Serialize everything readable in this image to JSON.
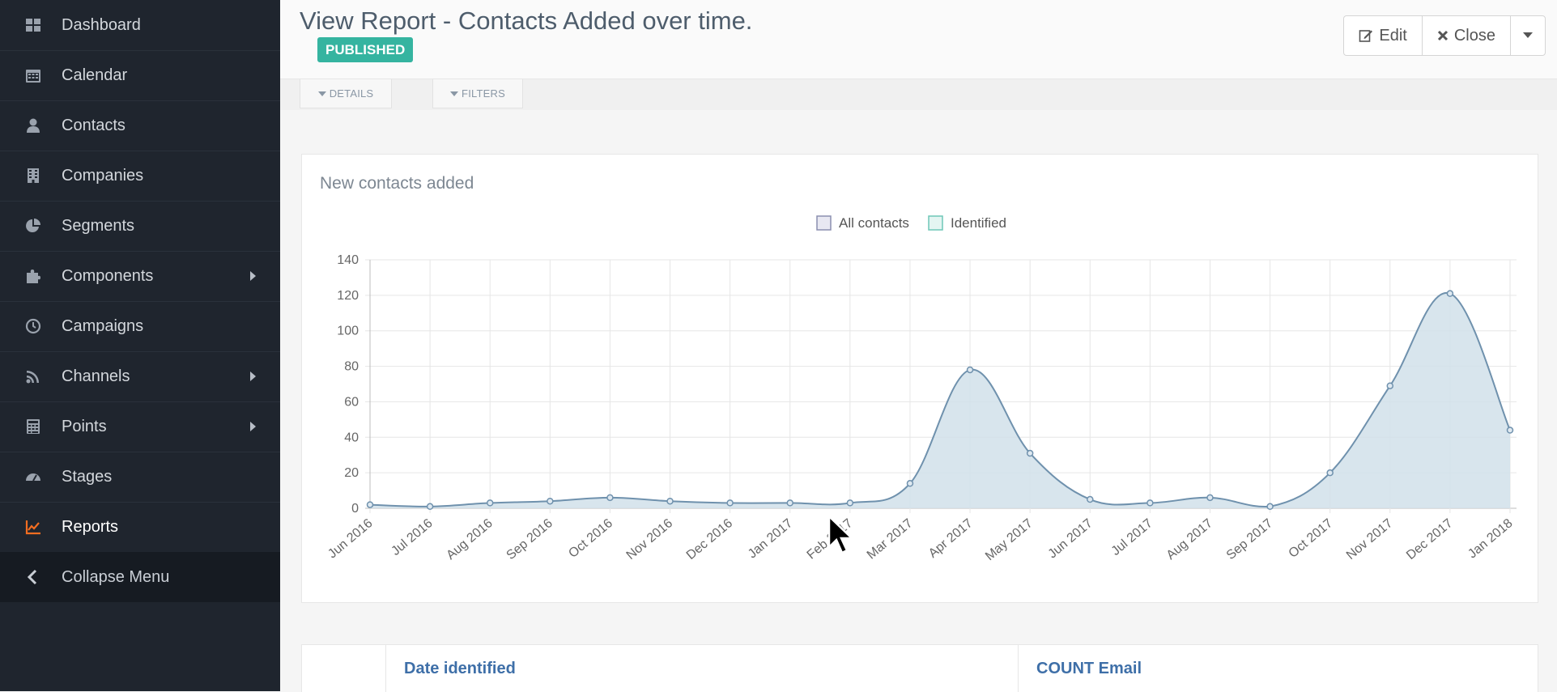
{
  "sidebar": {
    "items": [
      {
        "label": "Dashboard",
        "icon": "dashboard-icon",
        "has_submenu": false
      },
      {
        "label": "Calendar",
        "icon": "calendar-icon",
        "has_submenu": false
      },
      {
        "label": "Contacts",
        "icon": "user-icon",
        "has_submenu": false
      },
      {
        "label": "Companies",
        "icon": "building-icon",
        "has_submenu": false
      },
      {
        "label": "Segments",
        "icon": "pie-chart-icon",
        "has_submenu": false
      },
      {
        "label": "Components",
        "icon": "puzzle-icon",
        "has_submenu": true
      },
      {
        "label": "Campaigns",
        "icon": "clock-icon",
        "has_submenu": false
      },
      {
        "label": "Channels",
        "icon": "rss-icon",
        "has_submenu": true
      },
      {
        "label": "Points",
        "icon": "calculator-icon",
        "has_submenu": true
      },
      {
        "label": "Stages",
        "icon": "tachometer-icon",
        "has_submenu": false
      },
      {
        "label": "Reports",
        "icon": "line-chart-icon",
        "has_submenu": false,
        "active": true
      }
    ],
    "collapse_label": "Collapse Menu"
  },
  "header": {
    "title": "View Report - Contacts Added over time.",
    "status_badge": "PUBLISHED",
    "edit_label": "Edit",
    "close_label": "Close"
  },
  "tabs": {
    "details": "DETAILS",
    "filters": "FILTERS"
  },
  "panel": {
    "title": "New contacts added"
  },
  "colors": {
    "accent": "#f26d21",
    "badge": "#35b4a0",
    "series_line": "#6f91ad",
    "series_fill": "#d1e0ea",
    "link": "#3e6fa8"
  },
  "chart_data": {
    "type": "area",
    "legend_position": "top-center",
    "grid": true,
    "categories": [
      "Jun 2016",
      "Jul 2016",
      "Aug 2016",
      "Sep 2016",
      "Oct 2016",
      "Nov 2016",
      "Dec 2016",
      "Jan 2017",
      "Feb 2017",
      "Mar 2017",
      "Apr 2017",
      "May 2017",
      "Jun 2017",
      "Jul 2017",
      "Aug 2017",
      "Sep 2017",
      "Oct 2017",
      "Nov 2017",
      "Dec 2017",
      "Jan 2018"
    ],
    "ylim": [
      0,
      140
    ],
    "yticks": [
      0,
      20,
      40,
      60,
      80,
      100,
      120,
      140
    ],
    "series": [
      {
        "name": "All contacts",
        "values": [
          2,
          1,
          3,
          4,
          6,
          4,
          3,
          3,
          3,
          14,
          78,
          31,
          5,
          3,
          6,
          1,
          20,
          69,
          121,
          44
        ]
      },
      {
        "name": "Identified",
        "values": []
      }
    ]
  },
  "table": {
    "columns": [
      "Date identified",
      "COUNT Email"
    ]
  }
}
